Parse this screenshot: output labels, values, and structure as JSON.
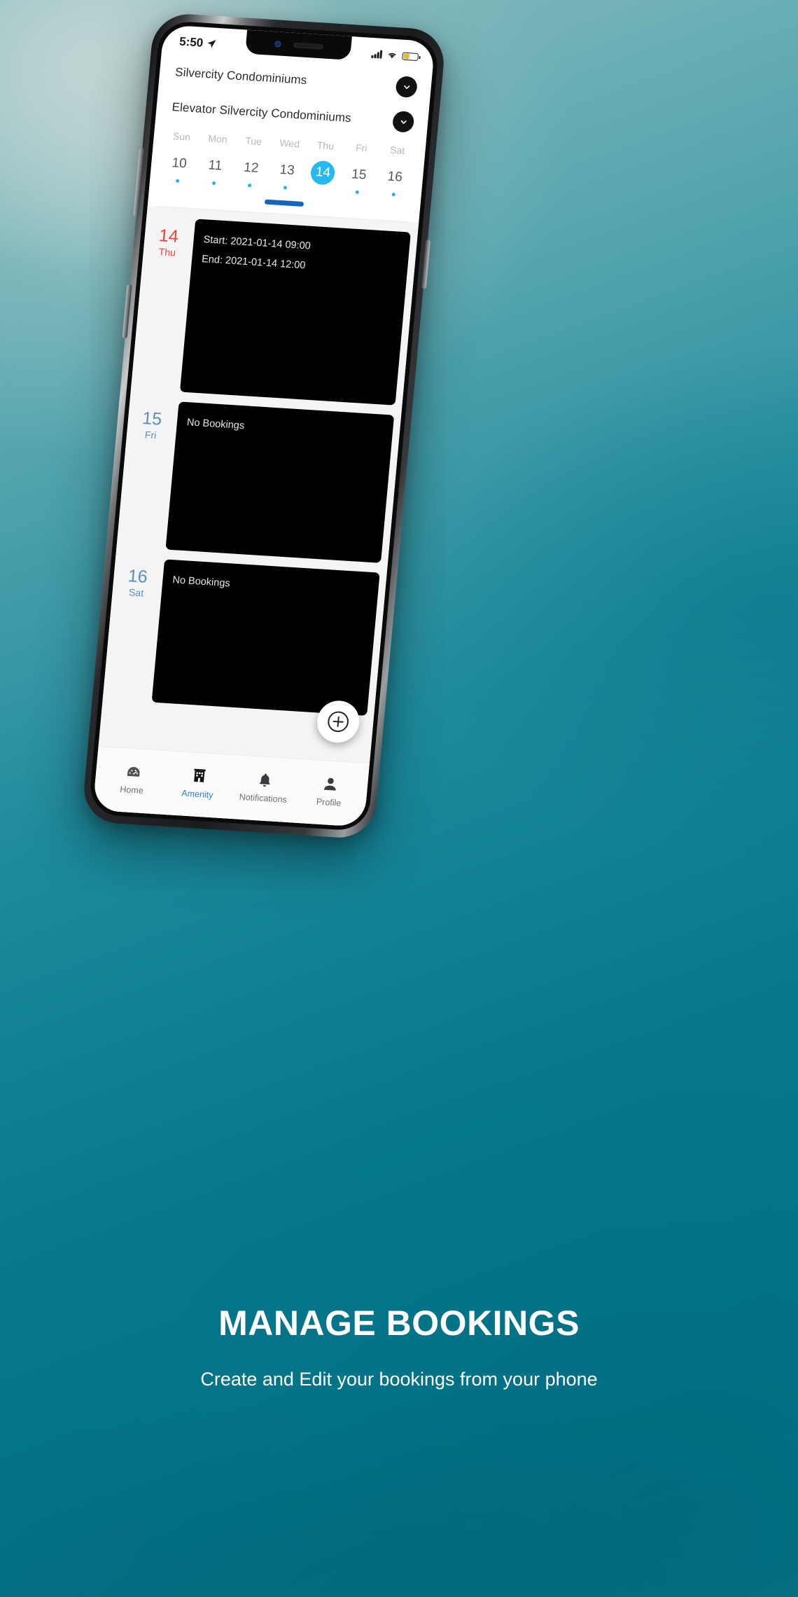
{
  "background": {
    "accent": "#06788e",
    "panel_black": "#000000",
    "selected_blue": "#26b9f0"
  },
  "phone": {
    "statusbar": {
      "time": "5:50",
      "location_icon": "location-arrow-icon",
      "signal_icon": "cellular-signal-icon",
      "wifi_icon": "wifi-icon",
      "battery_icon": "battery-icon"
    },
    "header": {
      "property_title": "Silvercity Condominiums",
      "amenity_title": "Elevator Silvercity Condominiums",
      "property_chevron": "chevron-down-icon",
      "amenity_chevron": "chevron-down-icon"
    },
    "week": {
      "days": [
        {
          "dow": "Sun",
          "date": "10",
          "selected": false,
          "has_dot": true
        },
        {
          "dow": "Mon",
          "date": "11",
          "selected": false,
          "has_dot": true
        },
        {
          "dow": "Tue",
          "date": "12",
          "selected": false,
          "has_dot": true
        },
        {
          "dow": "Wed",
          "date": "13",
          "selected": false,
          "has_dot": true
        },
        {
          "dow": "Thu",
          "date": "14",
          "selected": true,
          "has_dot": false
        },
        {
          "dow": "Fri",
          "date": "15",
          "selected": false,
          "has_dot": true
        },
        {
          "dow": "Sat",
          "date": "16",
          "selected": false,
          "has_dot": true
        }
      ]
    },
    "bookings": [
      {
        "date_num": "14",
        "date_dow": "Thu",
        "is_today": true,
        "line1": "Start: 2021-01-14 09:00",
        "line2": "End: 2021-01-14 12:00"
      },
      {
        "date_num": "15",
        "date_dow": "Fri",
        "is_today": false,
        "line1": "No Bookings",
        "line2": ""
      },
      {
        "date_num": "16",
        "date_dow": "Sat",
        "is_today": false,
        "line1": "No Bookings",
        "line2": ""
      }
    ],
    "fab": {
      "icon": "plus-circle-icon",
      "label": "Add booking"
    },
    "bottomnav": [
      {
        "label": "Home",
        "icon": "dashboard-gauge-icon",
        "active": false
      },
      {
        "label": "Amenity",
        "icon": "building-icon",
        "active": true
      },
      {
        "label": "Notifications",
        "icon": "bell-icon",
        "active": false
      },
      {
        "label": "Profile",
        "icon": "person-icon",
        "active": false
      }
    ]
  },
  "caption": {
    "headline": "MANAGE BOOKINGS",
    "subhead": "Create and Edit your bookings from your phone"
  }
}
